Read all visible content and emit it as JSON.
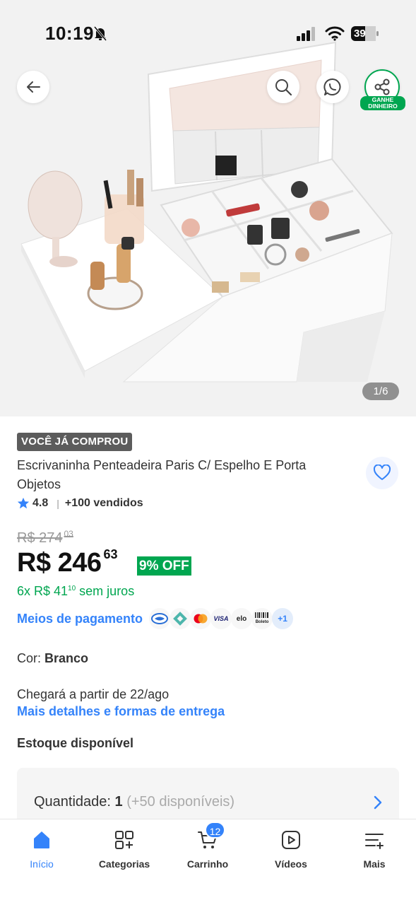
{
  "status_bar": {
    "time": "10:19",
    "battery": "39"
  },
  "hero": {
    "image_counter": "1/6",
    "share_badge_line1": "GANHE",
    "share_badge_line2": "DINHEIRO",
    "icons": [
      "back-arrow-icon",
      "search-icon",
      "whatsapp-icon",
      "share-icon"
    ]
  },
  "product": {
    "tag": "VOCÊ JÁ COMPROU",
    "title": "Escrivaninha Penteadeira Paris C/ Espelho E Porta Objetos",
    "rating": "4.8",
    "rating_separator": "|",
    "sold": "+100 vendidos",
    "old_price_main": "R$ 274",
    "old_price_cents": "03",
    "price_main": "R$ 246",
    "price_cents": "63",
    "discount": "9% OFF",
    "installments_prefix": "6x R$ 41",
    "installments_cents": "10",
    "installments_suffix": " sem juros",
    "payment_label": "Meios de pagamento",
    "payment_methods": {
      "visa": "VISA",
      "elo": "elo",
      "boleto": "Boleto",
      "more": "+1"
    },
    "color_label": "Cor: ",
    "color_value": "Branco",
    "delivery_text": "Chegará a partir de 22/ago",
    "delivery_link": "Mais detalhes e formas de entrega",
    "stock": "Estoque disponível",
    "quantity_label": "Quantidade: ",
    "quantity_value": "1",
    "quantity_available": "(+50 disponíveis)"
  },
  "bottom_nav": {
    "items": [
      {
        "label": "Início",
        "icon": "home-icon"
      },
      {
        "label": "Categorias",
        "icon": "categories-icon"
      },
      {
        "label": "Carrinho",
        "icon": "cart-icon"
      },
      {
        "label": "Vídeos",
        "icon": "video-icon"
      },
      {
        "label": "Mais",
        "icon": "menu-plus-icon"
      }
    ],
    "cart_count": "12"
  },
  "colors": {
    "accent_blue": "#3483fa",
    "green": "#00a650",
    "tag_gray": "#5c5c5c"
  }
}
